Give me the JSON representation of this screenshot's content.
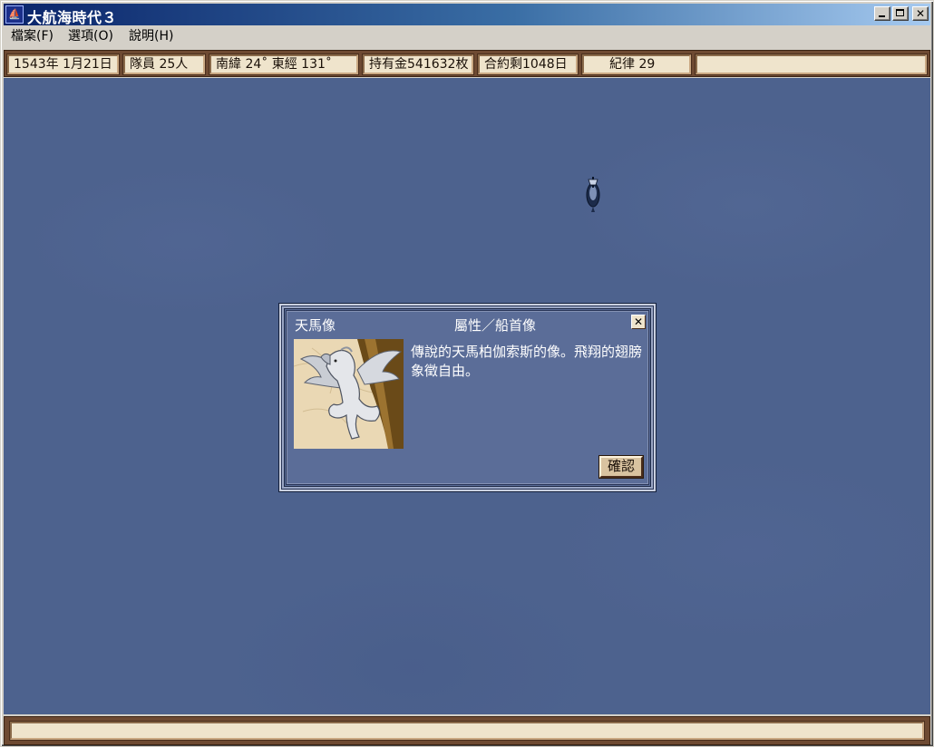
{
  "window": {
    "title": "大航海時代３",
    "app_icon": "ship-app-icon",
    "controls": [
      "minimize-icon",
      "maximize-icon",
      "close-icon"
    ]
  },
  "menu": {
    "items": [
      {
        "label": "檔案(F)"
      },
      {
        "label": "選項(O)"
      },
      {
        "label": "說明(H)"
      }
    ]
  },
  "status": {
    "date": "1543年  1月21日",
    "crew": "隊員    25人",
    "position": "南緯    24˚  東經  131˚",
    "gold": "持有金541632枚",
    "contract": "合約剩1048日",
    "discipline": "紀律    29"
  },
  "dialog": {
    "item_name": "天馬像",
    "item_type": "屬性／船首像",
    "description": "傳說的天馬柏伽索斯的像。飛翔的翅膀象徵自由。",
    "confirm_label": "確認",
    "close_icon": "close-icon",
    "image": "pegasus-figurehead-image"
  },
  "colors": {
    "sea": "#4d628e",
    "dialog_bg": "#5b6d98",
    "status_frame": "#6e4a32",
    "status_field": "#efe4cc",
    "titlebar_start": "#0a246a",
    "titlebar_end": "#a6caf0"
  }
}
